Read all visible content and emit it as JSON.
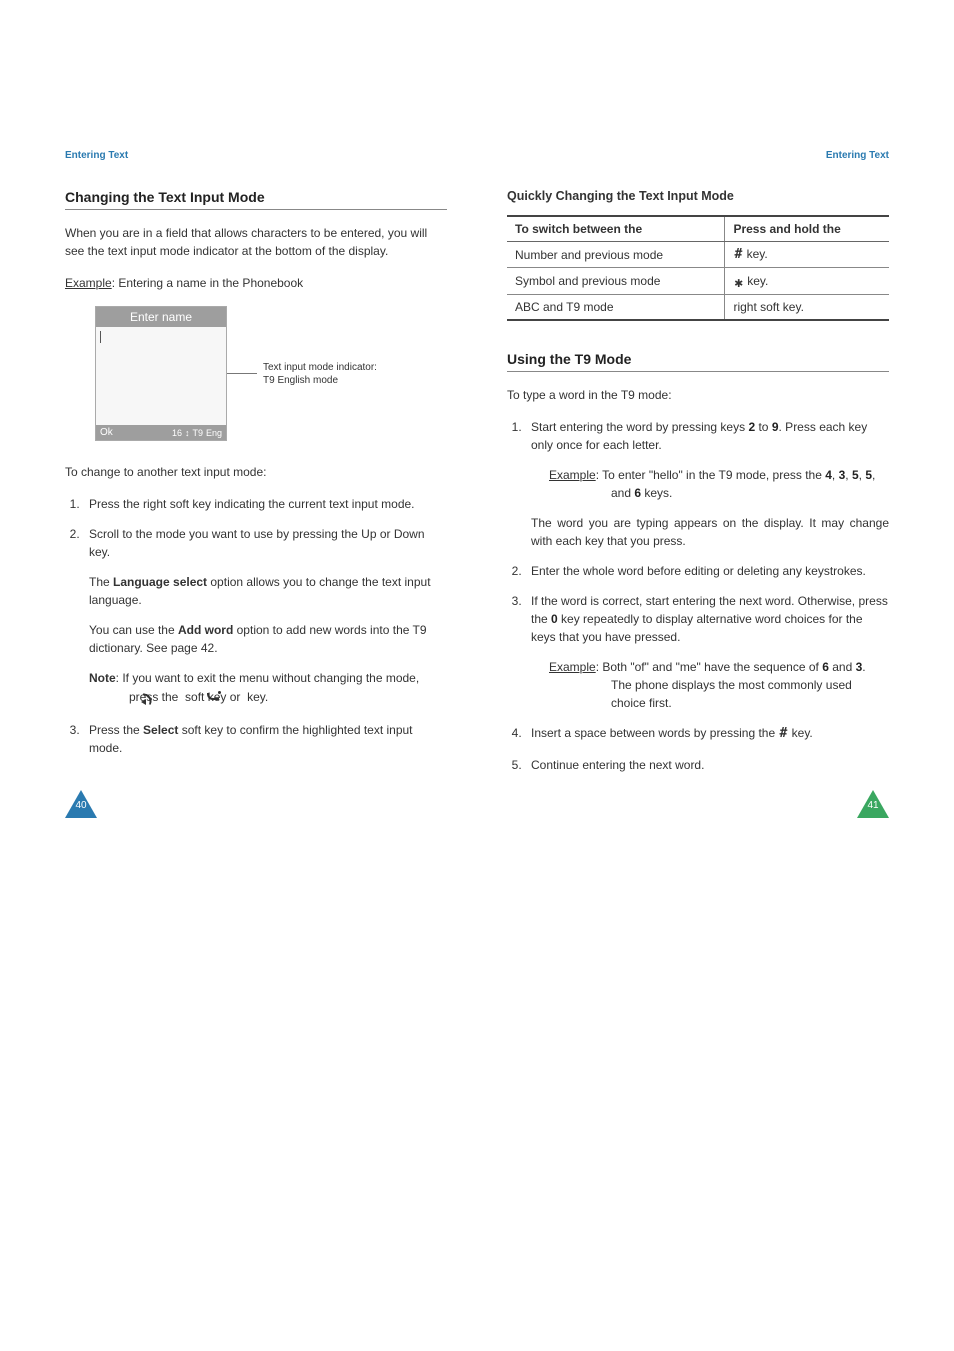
{
  "left": {
    "header": "Entering Text",
    "h2": "Changing the Text Input Mode",
    "intro": "When you are in a field that allows characters to be entered, you will see the text input mode indicator at the bottom of the display.",
    "example_label": "Example",
    "example_text": ": Entering a name in the Phonebook",
    "phone": {
      "title": "Enter name",
      "sk_left": "Ok",
      "sk_count": "16",
      "sk_arrow": "↕",
      "sk_t9": "T9",
      "sk_lang": "Eng"
    },
    "caption_l1": "Text input mode indicator:",
    "caption_l2": "T9 English mode",
    "change_intro": "To change to another text input mode:",
    "step1": "Press the right soft key indicating the current text input mode.",
    "step2": "Scroll to the mode you want to use by pressing the Up or Down key.",
    "lang_pre": "The ",
    "lang_bold": "Language select",
    "lang_post": " option allows you to change the text input language.",
    "add_pre": "You can use the ",
    "add_bold": "Add word",
    "add_post": " option to add new words into the T9 dictionary. See page 42.",
    "note_bold": "Note",
    "note_l1": ": If you want to exit the menu without changing the mode, press the ",
    "note_softkey": " soft key or ",
    "note_key2": " key.",
    "step3_pre": "Press the ",
    "step3_bold": "Select",
    "step3_post": " soft key to confirm the highlighted text input mode.",
    "page_num": "40"
  },
  "right": {
    "header": "Entering Text",
    "sub_h3": "Quickly Changing the Text Input Mode",
    "th1": "To switch between the",
    "th2": "Press and hold the",
    "r1c1": "Number and previous mode",
    "r1c2_suffix": " key.",
    "r2c1": "Symbol and previous mode",
    "r2c2_suffix": " key.",
    "r3c1": "ABC and T9 mode",
    "r3c2": "right soft key.",
    "h2": "Using the T9 Mode",
    "intro": "To type a word in the T9 mode:",
    "s1_a": "Start entering the word by pressing keys ",
    "s1_k1": "2",
    "s1_mid": " to ",
    "s1_k2": "9",
    "s1_b": ". Press each key only once for each letter.",
    "ex1_label": "Example",
    "ex1_a": ": To enter \"hello\" in the T9 mode, press the ",
    "ex1_k4": "4",
    "ex1_k3": "3",
    "ex1_k5a": "5",
    "ex1_k5b": "5",
    "ex1_and": ", and ",
    "ex1_k6": "6",
    "ex1_end": " keys.",
    "s1_note": "The word you are typing appears on the display. It may change with each key that you press.",
    "s2": "Enter the whole word before editing or deleting any keystrokes.",
    "s3_a": "If the word is correct, start entering the next word. Otherwise, press the ",
    "s3_k0": "0",
    "s3_b": " key repeatedly to display alternative word choices for the keys that you have pressed.",
    "ex2_label": "Example",
    "ex2_a": ": Both \"of\" and \"me\" have the sequence of ",
    "ex2_k6": "6",
    "ex2_and": " and ",
    "ex2_k3": "3",
    "ex2_b": ". The phone displays the most commonly used choice first.",
    "s4_a": "Insert a space between words by pressing the ",
    "s4_b": " key.",
    "s5": "Continue entering the next word.",
    "page_num": "41"
  }
}
